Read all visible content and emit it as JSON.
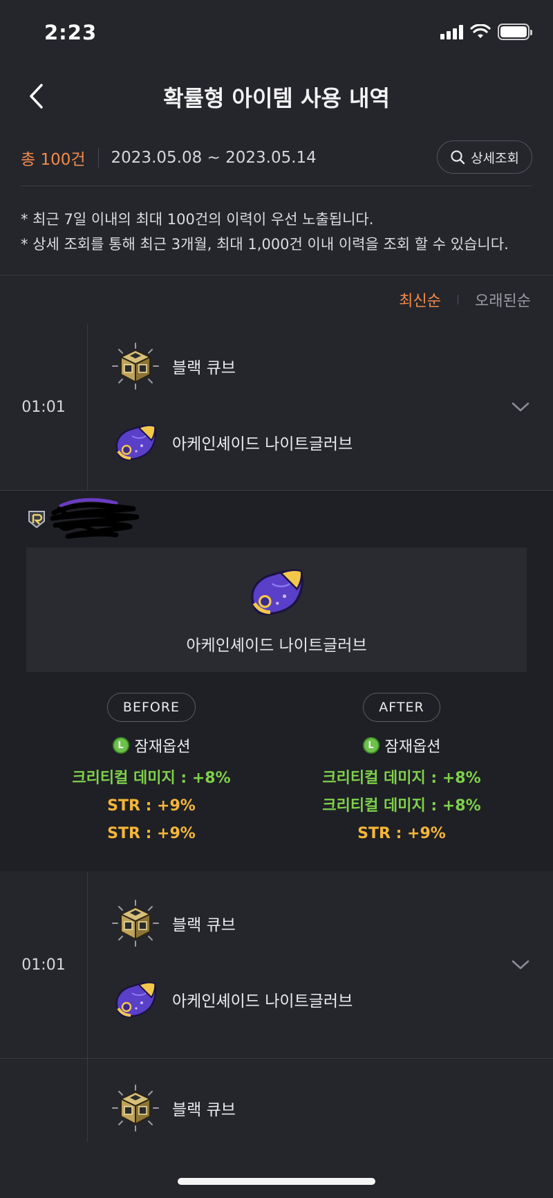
{
  "status_bar": {
    "time": "2:23"
  },
  "header": {
    "title": "확률형 아이템 사용 내역"
  },
  "summary": {
    "total": "총 100건",
    "range": "2023.05.08 ~ 2023.05.14",
    "detail_button": "상세조회"
  },
  "notice": {
    "line1": "* 최근 7일 이내의 최대 100건의 이력이 우선 노출됩니다.",
    "line2": "* 상세 조회를 통해 최근 3개월, 최대 1,000건 이내 이력을 조회 할 수 있습니다."
  },
  "sort": {
    "latest": "최신순",
    "oldest": "오래된순"
  },
  "entries": [
    {
      "time": "01:01",
      "cube": "블랙 큐브",
      "item": "아케인셰이드 나이트글러브"
    },
    {
      "time": "01:01",
      "cube": "블랙 큐브",
      "item": "아케인셰이드 나이트글러브"
    },
    {
      "cube": "블랙 큐브"
    }
  ],
  "detail": {
    "item_name": "아케인셰이드 나이트글러브",
    "before": {
      "label": "BEFORE",
      "option_title": "잠재옵션",
      "badge": "L",
      "lines": [
        "크리티컬 데미지 : +8%",
        "STR : +9%",
        "STR : +9%"
      ]
    },
    "after": {
      "label": "AFTER",
      "option_title": "잠재옵션",
      "badge": "L",
      "lines": [
        "크리티컬 데미지 : +8%",
        "크리티컬 데미지 : +8%",
        "STR : +9%"
      ]
    }
  },
  "colors": {
    "accent": "#f28a4a",
    "green": "#7fd14a",
    "gold": "#f5b638"
  },
  "icons": [
    "back-chevron-icon",
    "search-icon",
    "chevron-down-icon",
    "black-cube-icon",
    "glove-icon",
    "legendary-badge-icon"
  ]
}
